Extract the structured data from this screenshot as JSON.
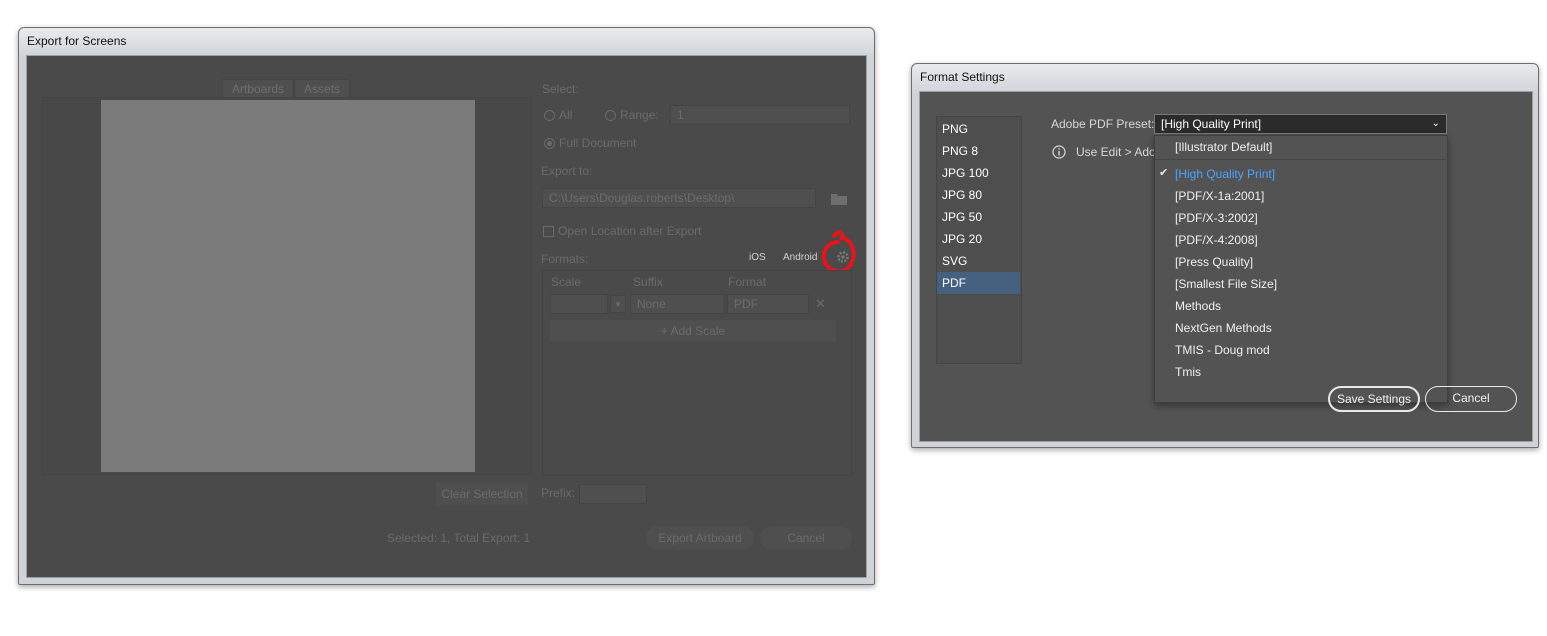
{
  "export_window": {
    "title": "Export for Screens",
    "tabs": [
      "Artboards",
      "Assets"
    ],
    "select_label": "Select:",
    "radio_all": "All",
    "radio_range": "Range:",
    "range_value": "1",
    "radio_full": "Full Document",
    "export_to_label": "Export to:",
    "export_path": "C:\\Users\\Douglas.roberts\\Desktop\\",
    "open_location": "Open Location after Export",
    "formats_label": "Formats:",
    "ios_label": "iOS",
    "android_label": "Android",
    "col_scale": "Scale",
    "col_suffix": "Suffix",
    "col_format": "Format",
    "suffix_placeholder": "None",
    "format_value": "PDF",
    "add_scale": "+ Add Scale",
    "clear_selection": "Clear Selection",
    "prefix_label": "Prefix:",
    "status": "Selected: 1, Total Export: 1",
    "export_button": "Export Artboard",
    "cancel_button": "Cancel",
    "annotation_color": "#e8141a"
  },
  "format_window": {
    "title": "Format Settings",
    "formats": [
      "PNG",
      "PNG 8",
      "JPG 100",
      "JPG 80",
      "JPG 50",
      "JPG 20",
      "SVG",
      "PDF"
    ],
    "selected_format": "PDF",
    "preset_label": "Adobe PDF Preset:",
    "preset_value": "[High Quality Print]",
    "info_text": "Use Edit > Ado",
    "dropdown_items": [
      "[Illustrator Default]",
      "[High Quality Print]",
      "[PDF/X-1a:2001]",
      "[PDF/X-3:2002]",
      "[PDF/X-4:2008]",
      "[Press Quality]",
      "[Smallest File Size]",
      "Methods",
      "NextGen Methods",
      "TMIS - Doug mod",
      "Tmis"
    ],
    "dropdown_selected": "[High Quality Print]",
    "save_button": "Save Settings",
    "cancel_button": "Cancel",
    "accent_color": "#4da3ff"
  }
}
